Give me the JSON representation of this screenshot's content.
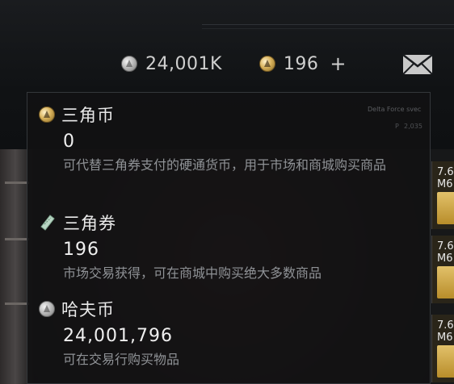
{
  "hud": {
    "silver_balance": "24,001K",
    "gold_balance": "196",
    "plus_label": "+",
    "icons": {
      "silver": "havoc-coin-icon",
      "gold": "delta-coin-icon",
      "mail": "mail-icon"
    }
  },
  "tooltip": {
    "entries": [
      {
        "name": "三角币",
        "amount": "0",
        "desc": "可代替三角券支付的硬通货币，用于市场和商城购买商品",
        "icon": "delta-coin-icon"
      },
      {
        "name": "三角券",
        "amount": "196",
        "desc": "市场交易获得，可在商城中购买绝大多数商品",
        "icon": "delta-ticket-icon"
      },
      {
        "name": "哈夫币",
        "amount": "24,001,796",
        "desc": "可在交易行购买物品",
        "icon": "havoc-coin-icon"
      }
    ]
  },
  "background": {
    "faint_text_1": "Delta Force svec",
    "faint_text_2": "2,035",
    "faint_p": "P",
    "ammo_label": "7.6\nM6"
  },
  "colors": {
    "panel_bg": "#121213",
    "desc_text": "#8f9296",
    "gold_coin": "#d8b25c",
    "silver_coin": "#bdbdbd"
  }
}
